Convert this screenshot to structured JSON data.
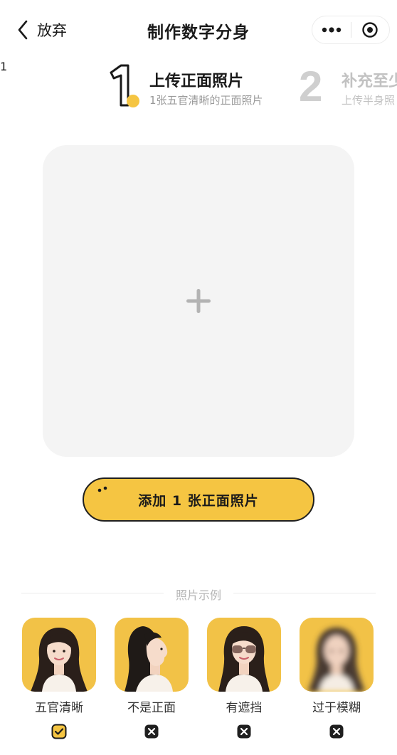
{
  "header": {
    "back_label": "放弃",
    "title": "制作数字分身",
    "more_icon": "more-dots-icon",
    "target_icon": "target-circle-icon"
  },
  "steps": [
    {
      "number": "1",
      "title": "上传正面照片",
      "subtitle": "1张五官清晰的正面照片",
      "active": true
    },
    {
      "number": "2",
      "title": "补充至少",
      "subtitle": "上传半身照",
      "active": false
    }
  ],
  "upload": {
    "icon": "plus-icon"
  },
  "add_button": {
    "label": "添加 1 张正面照片"
  },
  "examples_section": {
    "label": "照片示例",
    "items": [
      {
        "caption": "五官清晰",
        "status": "ok",
        "status_icon": "check-icon"
      },
      {
        "caption": "不是正面",
        "status": "bad",
        "status_icon": "cross-icon"
      },
      {
        "caption": "有遮挡",
        "status": "bad",
        "status_icon": "cross-icon"
      },
      {
        "caption": "过于模糊",
        "status": "bad",
        "status_icon": "cross-icon"
      }
    ]
  },
  "colors": {
    "accent": "#f5c542",
    "background": "#ffffff",
    "upload_box": "#f4f4f4",
    "muted_text": "#9a9a9a",
    "inactive_step": "#c2c2c2"
  }
}
